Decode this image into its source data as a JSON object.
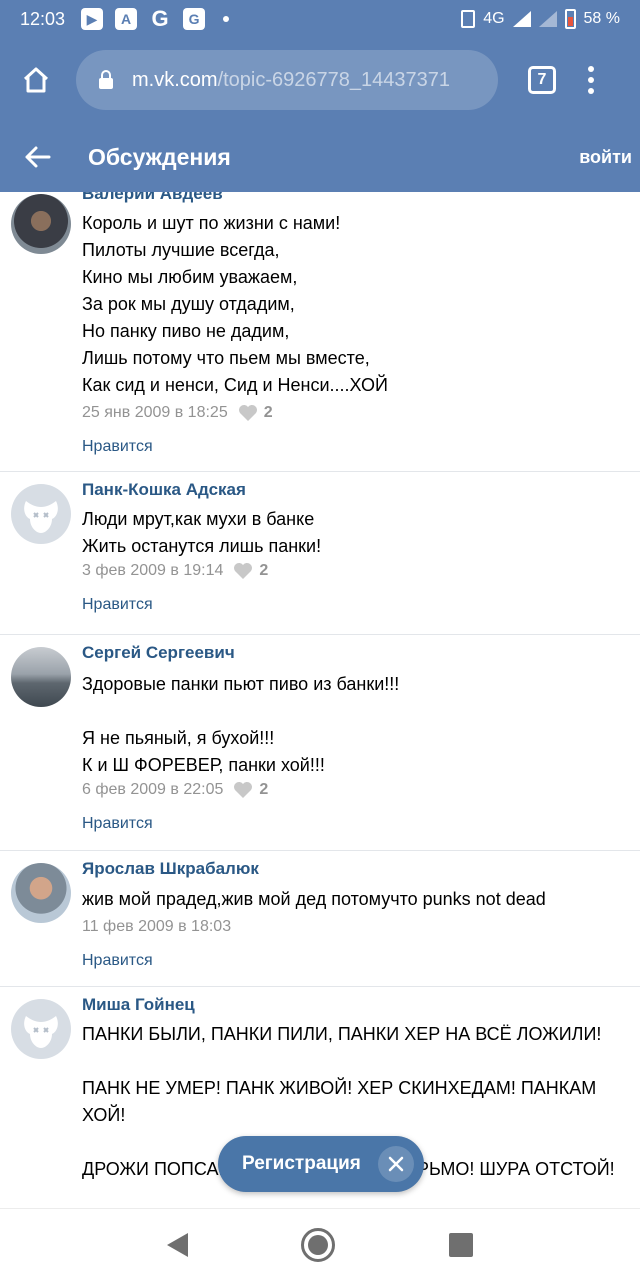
{
  "status_bar": {
    "time": "12:03",
    "network": "4G",
    "battery": "58 %",
    "app_icons": [
      "play-store-icon",
      "translate-icon",
      "google-icon",
      "news-icon"
    ]
  },
  "browser": {
    "url_domain": "m.vk.com",
    "url_path": "/topic-6926778_14437371",
    "tab_count": "7"
  },
  "header": {
    "title": "Обсуждения",
    "login": "войти"
  },
  "colors": {
    "brand": "#5b7fb3",
    "link": "#2a5885",
    "button": "#4a76a8",
    "meta": "#939393"
  },
  "posts": [
    {
      "author": "Валерий Авдеев",
      "text": "Король и шут по жизни с нами!\nПилоты лучшие всегда,\nКино мы любим уважаем,\nЗа рок мы душу отдадим,\nНо панку пиво не дадим,\nЛишь потому что пьем мы вместе,\nКак сид и ненси, Сид и Ненси....ХОЙ",
      "date": "25 янв 2009 в 18:25",
      "likes": "2",
      "like_label": "Нравится"
    },
    {
      "author": "Панк-Кошка Адская",
      "text": "Люди мрут,как мухи в банке\nЖить останутся лишь панки!",
      "date": "3 фев 2009 в 19:14",
      "likes": "2",
      "like_label": "Нравится"
    },
    {
      "author": "Сергей Сергеевич",
      "text": "Здоровые панки пьют пиво из банки!!!\n\nЯ не пьяный, я бухой!!!\nК и Ш ФОРЕВЕР, панки хой!!!",
      "date": "6 фев 2009 в 22:05",
      "likes": "2",
      "like_label": "Нравится"
    },
    {
      "author": "Ярослав Шкрабалюк",
      "text": "жив мой прадед,жив мой дед потомучто punks not dead",
      "date": "11 фев 2009 в 18:03",
      "likes": "",
      "like_label": "Нравится"
    },
    {
      "author": "Миша Гойнец",
      "text": "ПАНКИ БЫЛИ, ПАНКИ ПИЛИ, ПАНКИ ХЕР НА ВСЁ ЛОЖИЛИ!\n\nПАНК НЕ УМЕР! ПАНК ЖИВОЙ! ХЕР СКИНХЕДАМ! ПАНКАМ ХОЙ!\n\nДРОЖИ ПОПСА! ВСЕЙ ЭСТРАДАТУ ДЕРЬМО! ШУРА ОТСТОЙ!",
      "date": "",
      "likes": "",
      "like_label": ""
    }
  ],
  "registration": {
    "label": "Регистрация"
  }
}
